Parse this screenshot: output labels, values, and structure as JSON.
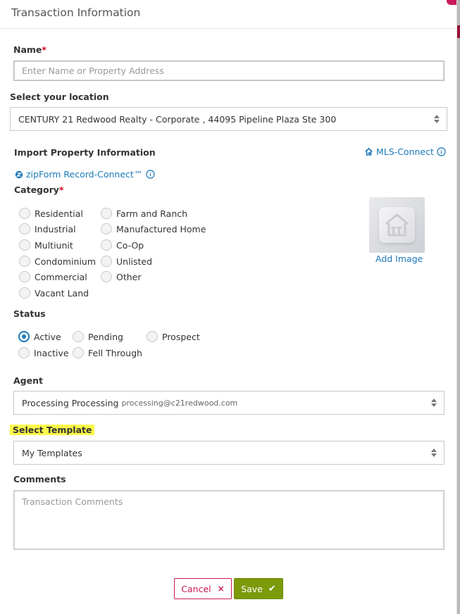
{
  "modal": {
    "title": "Transaction Information"
  },
  "name": {
    "label": "Name",
    "required": "*",
    "placeholder": "Enter Name or Property Address"
  },
  "location": {
    "label": "Select your location",
    "value": "CENTURY 21 Redwood Realty - Corporate , 44095 Pipeline Plaza Ste 300"
  },
  "import": {
    "label": "Import Property Information",
    "mls_link": "MLS-Connect",
    "zipform_link": "zipForm Record-Connect™"
  },
  "category": {
    "label": "Category",
    "required": "*",
    "col1": [
      "Residential",
      "Industrial",
      "Multiunit",
      "Condominium",
      "Commercial",
      "Vacant Land"
    ],
    "col2": [
      "Farm and Ranch",
      "Manufactured Home",
      "Co-Op",
      "Unlisted",
      "Other"
    ],
    "add_image": "Add Image"
  },
  "status": {
    "label": "Status",
    "options": [
      "Active",
      "Pending",
      "Prospect",
      "Inactive",
      "Fell Through"
    ],
    "selected": "Active"
  },
  "agent": {
    "label": "Agent",
    "name": "Processing Processing",
    "email": "processing@c21redwood.com"
  },
  "template": {
    "label": "Select Template",
    "value": "My Templates"
  },
  "comments": {
    "label": "Comments",
    "placeholder": "Transaction Comments"
  },
  "buttons": {
    "cancel": "Cancel",
    "save": "Save"
  },
  "colors": {
    "accent": "#1a78b8",
    "save": "#7c9a0a",
    "cancel": "#c8195a",
    "highlight": "#fbf94a",
    "required": "#d0021b"
  }
}
